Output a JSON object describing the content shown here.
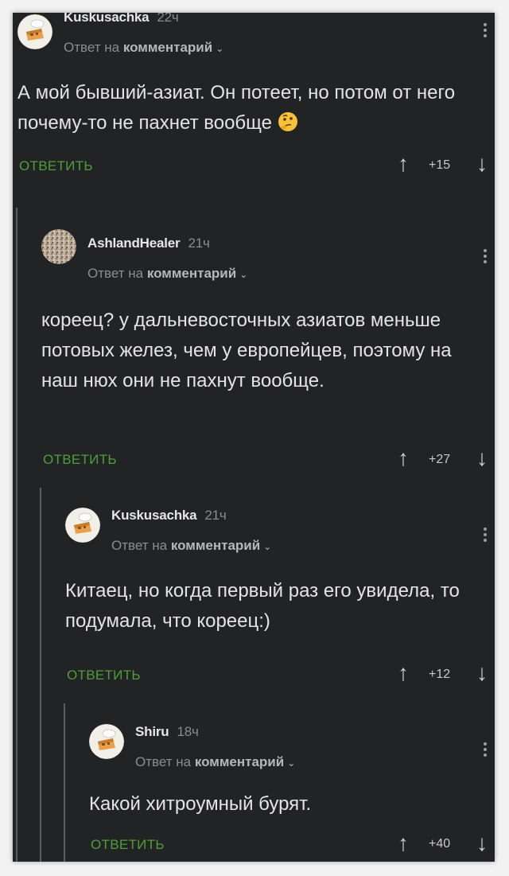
{
  "comments": [
    {
      "author": "Kuskusachka",
      "time": "22ч",
      "reply_prefix": "Ответ на",
      "reply_target": "комментарий",
      "text": "А мой бывший-азиат. Он потеет, но потом от него почему-то не пахнет вообще",
      "reply_label": "ОТВЕТИТЬ",
      "rating": "+15",
      "avatar": "cake"
    },
    {
      "author": "AshlandHealer",
      "time": "21ч",
      "reply_prefix": "Ответ на",
      "reply_target": "комментарий",
      "text": "кореец? у дальневосточных азиатов меньше потовых желез, чем у европейцев, поэтому на наш нюх они не пахнут вообще.",
      "reply_label": "ОТВЕТИТЬ",
      "rating": "+27",
      "avatar": "noise"
    },
    {
      "author": "Kuskusachka",
      "time": "21ч",
      "reply_prefix": "Ответ на",
      "reply_target": "комментарий",
      "text": "Китаец, но когда первый раз его увидела, то подумала, что кореец:)",
      "reply_label": "ОТВЕТИТЬ",
      "rating": "+12",
      "avatar": "cake"
    },
    {
      "author": "Shiru",
      "time": "18ч",
      "reply_prefix": "Ответ на",
      "reply_target": "комментарий",
      "text": "Какой хитроумный бурят.",
      "reply_label": "ОТВЕТИТЬ",
      "rating": "+40",
      "avatar": "cake"
    }
  ],
  "icons": {
    "upvote": "arrow-up-icon",
    "downvote": "arrow-down-icon",
    "menu": "more-vertical-icon",
    "emoji": "thinking-face-emoji"
  },
  "colors": {
    "background": "#212325",
    "reply": "#4f9e3a",
    "text": "#e4e4e4",
    "muted": "#8a8c8f"
  }
}
